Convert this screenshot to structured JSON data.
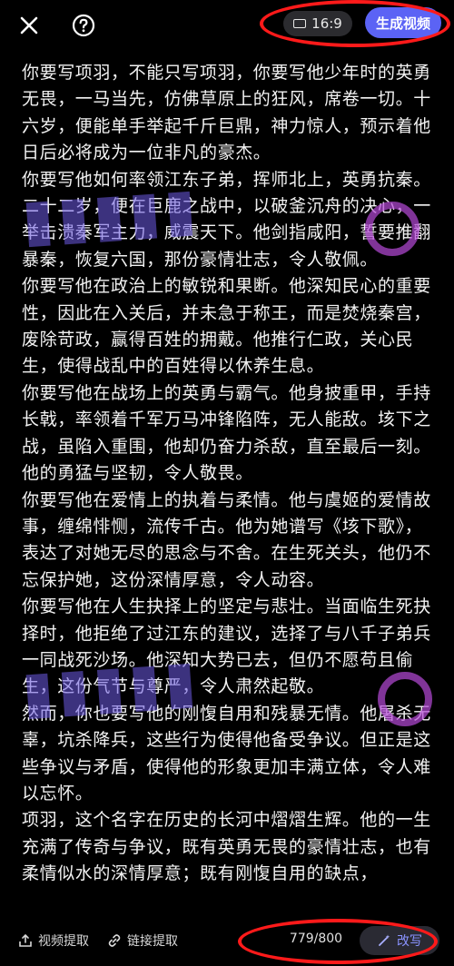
{
  "topbar": {
    "ratio_label": "16:9",
    "generate_label": "生成视频"
  },
  "content": {
    "paragraphs": [
      "你要写项羽，不能只写项羽，你要写他少年时的英勇无畏，一马当先，仿佛草原上的狂风，席卷一切。十六岁，便能单手举起千斤巨鼎，神力惊人，预示着他日后必将成为一位非凡的豪杰。",
      "你要写他如何率领江东子弟，挥师北上，英勇抗秦。二十二岁，便在巨鹿之战中，以破釜沉舟的决心，一举击溃秦军主力，威震天下。他剑指咸阳，誓要推翻暴秦，恢复六国，那份豪情壮志，令人敬佩。",
      "你要写他在政治上的敏锐和果断。他深知民心的重要性，因此在入关后，并未急于称王，而是焚烧秦宫，废除苛政，赢得百姓的拥戴。他推行仁政，关心民生，使得战乱中的百姓得以休养生息。",
      "你要写他在战场上的英勇与霸气。他身披重甲，手持长戟，率领着千军万马冲锋陷阵，无人能敌。垓下之战，虽陷入重围，他却仍奋力杀敌，直至最后一刻。他的勇猛与坚韧，令人敬畏。",
      "你要写他在爱情上的执着与柔情。他与虞姬的爱情故事，缠绵悱恻，流传千古。他为她谱写《垓下歌》，表达了对她无尽的思念与不舍。在生死关头，他仍不忘保护她，这份深情厚意，令人动容。",
      "你要写他在人生抉择上的坚定与悲壮。当面临生死抉择时，他拒绝了过江东的建议，选择了与八千子弟兵一同战死沙场。他深知大势已去，但仍不愿苟且偷生，这份气节与尊严，令人肃然起敬。",
      "然而，你也要写他的刚愎自用和残暴无情。他屠杀无辜，坑杀降兵，这些行为使得他备受争议。但正是这些争议与矛盾，使得他的形象更加丰满立体，令人难以忘怀。",
      "项羽，这个名字在历史的长河中熠熠生辉。他的一生充满了传奇与争议，既有英勇无畏的豪情壮志，也有柔情似水的深情厚意；既有刚愎自用的缺点，"
    ]
  },
  "bottombar": {
    "video_extract_label": "视频提取",
    "link_extract_label": "链接提取",
    "counter": "779/800",
    "rewrite_label": "改写"
  },
  "colors": {
    "background": "#000000",
    "accent": "#5b63f5",
    "annotation": "#ff1a1a"
  }
}
